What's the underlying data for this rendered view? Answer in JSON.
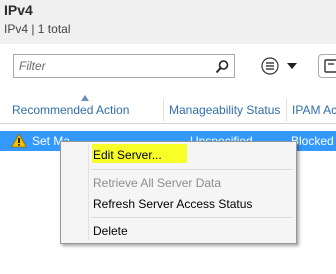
{
  "header": {
    "title": "IPv4",
    "subtitle": "IPv4 | 1 total"
  },
  "filter": {
    "placeholder": "Filter"
  },
  "columns": [
    "Recommended Action",
    "Manageability Status",
    "IPAM Ac"
  ],
  "row": {
    "action": "Set Ma",
    "manageability": "Unspecified",
    "ipam_access": "Blocked"
  },
  "context_menu": {
    "items": [
      "Edit Server...",
      "Retrieve All Server Data",
      "Refresh Server Access Status",
      "Delete"
    ]
  },
  "colors": {
    "selection": "#3399ff",
    "highlight": "#f8ff28",
    "column_header_text": "#2f6ea8"
  }
}
